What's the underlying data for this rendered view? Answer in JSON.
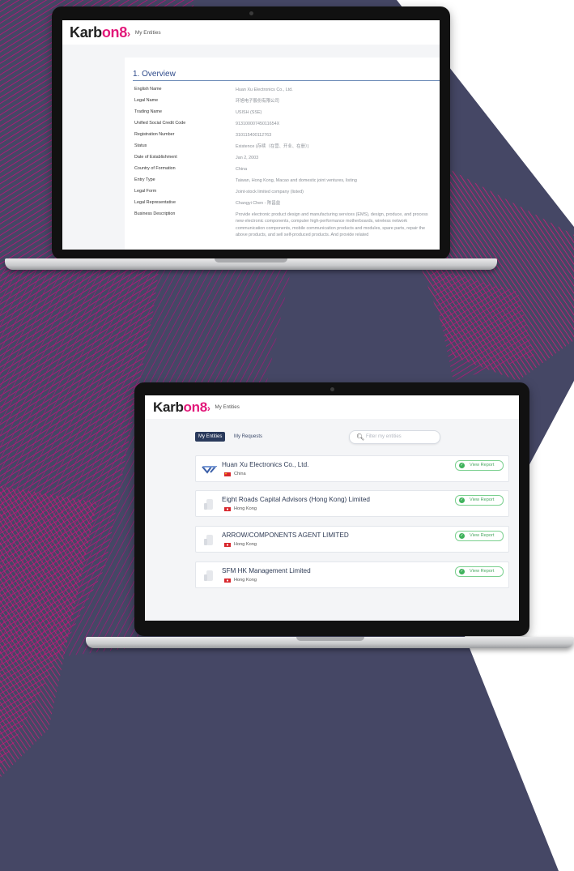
{
  "brand": {
    "logo_prefix": "Karb",
    "logo_suffix": "on8",
    "logo_chevron": "›",
    "accent": "#e2197a",
    "dark_bg": "#454765"
  },
  "overview_screen": {
    "header_title": "My Entities",
    "section_title": "1. Overview",
    "rows": [
      {
        "label": "English Name",
        "value": "Huan Xu Electronics Co., Ltd."
      },
      {
        "label": "Legal Name",
        "value": "环旭电子股份有限公司"
      },
      {
        "label": "Trading Name",
        "value": "USISH (SSE)"
      },
      {
        "label": "Unified Social Credit Code",
        "value": "91310000745011654X"
      },
      {
        "label": "Registration Number",
        "value": "310115400112763"
      },
      {
        "label": "Status",
        "value": "Existence (存续（在营、开业、在册）)"
      },
      {
        "label": "Date of Establishment",
        "value": "Jan 2, 2003"
      },
      {
        "label": "Country of Formation",
        "value": "China"
      },
      {
        "label": "Entry Type",
        "value": "Taiwan, Hong Kong, Macao and domestic joint ventures, listing"
      },
      {
        "label": "Legal Form",
        "value": "Joint-stock limited company (listed)"
      },
      {
        "label": "Legal Representative",
        "value": "Changyi Chen - 陈昌益"
      },
      {
        "label": "Business Description",
        "value": "Provide electronic product design and manufacturing services (EMS), design, produce, and process new electronic components, computer high-performance motherboards, wireless network communication components, mobile communication products and modules, spare parts, repair the above products, and sell self-produced products. And provide related"
      }
    ]
  },
  "entities_screen": {
    "header_title": "My Entities",
    "tabs": [
      {
        "label": "My Entities",
        "active": true
      },
      {
        "label": "My Requests",
        "active": false
      }
    ],
    "search": {
      "icon": "search-icon",
      "placeholder": "Filter my entities"
    },
    "entities": [
      {
        "name": "Huan Xu Electronics Co., Ltd.",
        "country": "China",
        "flag": "china-flag",
        "action": "View Report"
      },
      {
        "name": "Eight Roads Capital Advisors (Hong Kong) Limited",
        "country": "Hong Kong",
        "flag": "hong-kong-flag",
        "action": "View Report"
      },
      {
        "name": "ARROW/COMPONENTS AGENT LIMITED",
        "country": "Hong Kong",
        "flag": "hong-kong-flag",
        "action": "View Report"
      },
      {
        "name": "SFM HK Management Limited",
        "country": "Hong Kong",
        "flag": "hong-kong-flag",
        "action": "View Report"
      }
    ]
  }
}
